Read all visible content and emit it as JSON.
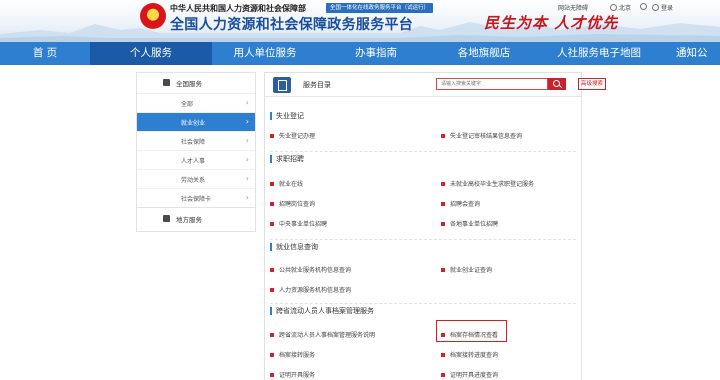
{
  "header": {
    "ministry": "中华人民共和国人力资源和社会保障部",
    "beta_badge": "全国一体化在线政务服务平台（试运行）",
    "site_title": "全国人力资源和社会保障政务服务平台",
    "slogan": "民生为本 人才优先",
    "links": {
      "accessibility": "网站无障碍",
      "location": "北京",
      "login": "登录"
    }
  },
  "nav": {
    "items": [
      {
        "label": "首 页"
      },
      {
        "label": "个人服务"
      },
      {
        "label": "用人单位服务"
      },
      {
        "label": "办事指南"
      },
      {
        "label": "各地旗舰店"
      },
      {
        "label": "人社服务电子地图"
      },
      {
        "label": "通知公"
      }
    ],
    "active_index": 1
  },
  "sidebar": {
    "group_title": "全国服务",
    "items": [
      {
        "label": "全部"
      },
      {
        "label": "就业创业"
      },
      {
        "label": "社会保障"
      },
      {
        "label": "人才人事"
      },
      {
        "label": "劳动关系"
      },
      {
        "label": "社会保障卡"
      }
    ],
    "active_index": 1,
    "bottom": "地方服务"
  },
  "panel": {
    "title": "服务目录",
    "search_placeholder": "请输入搜索关键字",
    "advanced_search": "高级搜索",
    "sections": [
      {
        "title": "失业登记",
        "items": [
          "失业登记办理",
          "失业登记审核结果信息查询"
        ]
      },
      {
        "title": "求职招聘",
        "items": [
          "就业在线",
          "未就业高校毕业生求职登记服务",
          "招聘岗位查询",
          "招聘会查询",
          "中央事业单位招聘",
          "各地事业单位招聘"
        ]
      },
      {
        "title": "就业信息查询",
        "items": [
          "公共就业服务机构信息查询",
          "就业创业证查询",
          "人力资源服务机构信息查询"
        ]
      },
      {
        "title": "跨省流动人员人事档案管理服务",
        "items": [
          "跨省流动人员人事档案管理服务说明",
          "档案存档情况查看",
          "档案接转服务",
          "档案接转进度查询",
          "证明开具服务",
          "证明开具进度查询"
        ]
      }
    ]
  }
}
